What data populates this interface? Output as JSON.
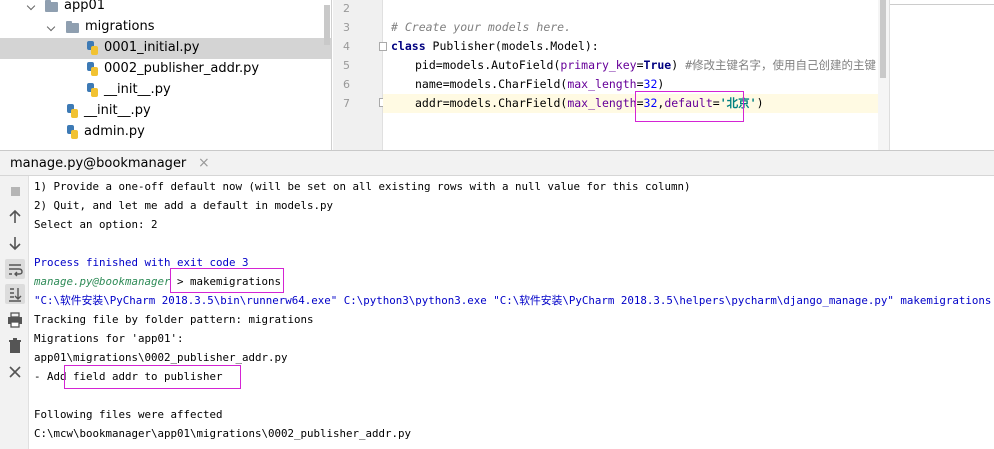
{
  "project_tree": {
    "items": [
      {
        "label": "app01",
        "type": "folder",
        "expanded": true,
        "indent": 0
      },
      {
        "label": "migrations",
        "type": "folder",
        "expanded": true,
        "indent": 1
      },
      {
        "label": "0001_initial.py",
        "type": "python-file",
        "selected": true,
        "indent": 2
      },
      {
        "label": "0002_publisher_addr.py",
        "type": "python-file",
        "indent": 2
      },
      {
        "label": "__init__.py",
        "type": "python-file",
        "indent": 2
      },
      {
        "label": "__init__.py",
        "type": "python-file",
        "indent": 1
      },
      {
        "label": "admin.py",
        "type": "python-file",
        "indent": 1
      }
    ]
  },
  "editor": {
    "line_numbers": [
      "2",
      "3",
      "4",
      "5",
      "6",
      "7"
    ],
    "lines": {
      "l3_comment": "# Create your models here.",
      "l4_kw": "class",
      "l4_rest": " Publisher(models.Model):",
      "l5_a": "pid=models.AutoField(",
      "l5_param": "primary_key",
      "l5_eq": "=",
      "l5_true": "True",
      "l5_close": ")",
      "l5_comment": " #修改主键名字，使用自己创建的主键",
      "l6_a": "name=models.CharField(",
      "l6_param": "max_length",
      "l6_eq": "=",
      "l6_num": "32",
      "l6_close": ")",
      "l7_a": "addr=models.CharField(",
      "l7_param": "max_length",
      "l7_eq": "=",
      "l7_num": "32",
      "l7_comma": ",",
      "l7_param2": "default",
      "l7_eq2": "=",
      "l7_str": "'北京'",
      "l7_close": ")"
    }
  },
  "run_panel": {
    "title": "manage.py@bookmanager",
    "close_glyph": "×",
    "toolbar_icons": [
      "stop-icon",
      "up-arrow-icon",
      "down-arrow-icon",
      "soft-wrap-icon",
      "scroll-to-end-icon",
      "print-icon",
      "trash-icon",
      "close-icon"
    ],
    "console_lines": {
      "c1": " 1) Provide a one-off default now (will be set on all existing rows with a null value for this column)",
      "c2": " 2) Quit, and let me add a default in models.py",
      "c3": "Select an option:  2",
      "c4": "Process finished with exit code 3",
      "c5_prompt": "manage.py@bookmanager",
      "c5_sep": " > ",
      "c5_cmd": "makemigrations",
      "c6": "\"C:\\软件安装\\PyCharm 2018.3.5\\bin\\runnerw64.exe\" C:\\python3\\python3.exe \"C:\\软件安装\\PyCharm 2018.3.5\\helpers\\pycharm\\django_manage.py\" makemigrations C:/mcw/bo",
      "c7": "Tracking file by folder pattern:  migrations",
      "c8": "Migrations for 'app01':",
      "c9": "  app01\\migrations\\0002_publisher_addr.py",
      "c10": "    - Add field addr to publisher",
      "c11": "Following files were affected",
      "c12": " C:\\mcw\\bookmanager\\app01\\migrations\\0002_publisher_addr.py"
    }
  },
  "colors": {
    "highlight_box": "#d424d4",
    "console_blue": "#0000c8",
    "prompt_green": "#2e8b57",
    "selected_row": "#d4d4d4"
  }
}
